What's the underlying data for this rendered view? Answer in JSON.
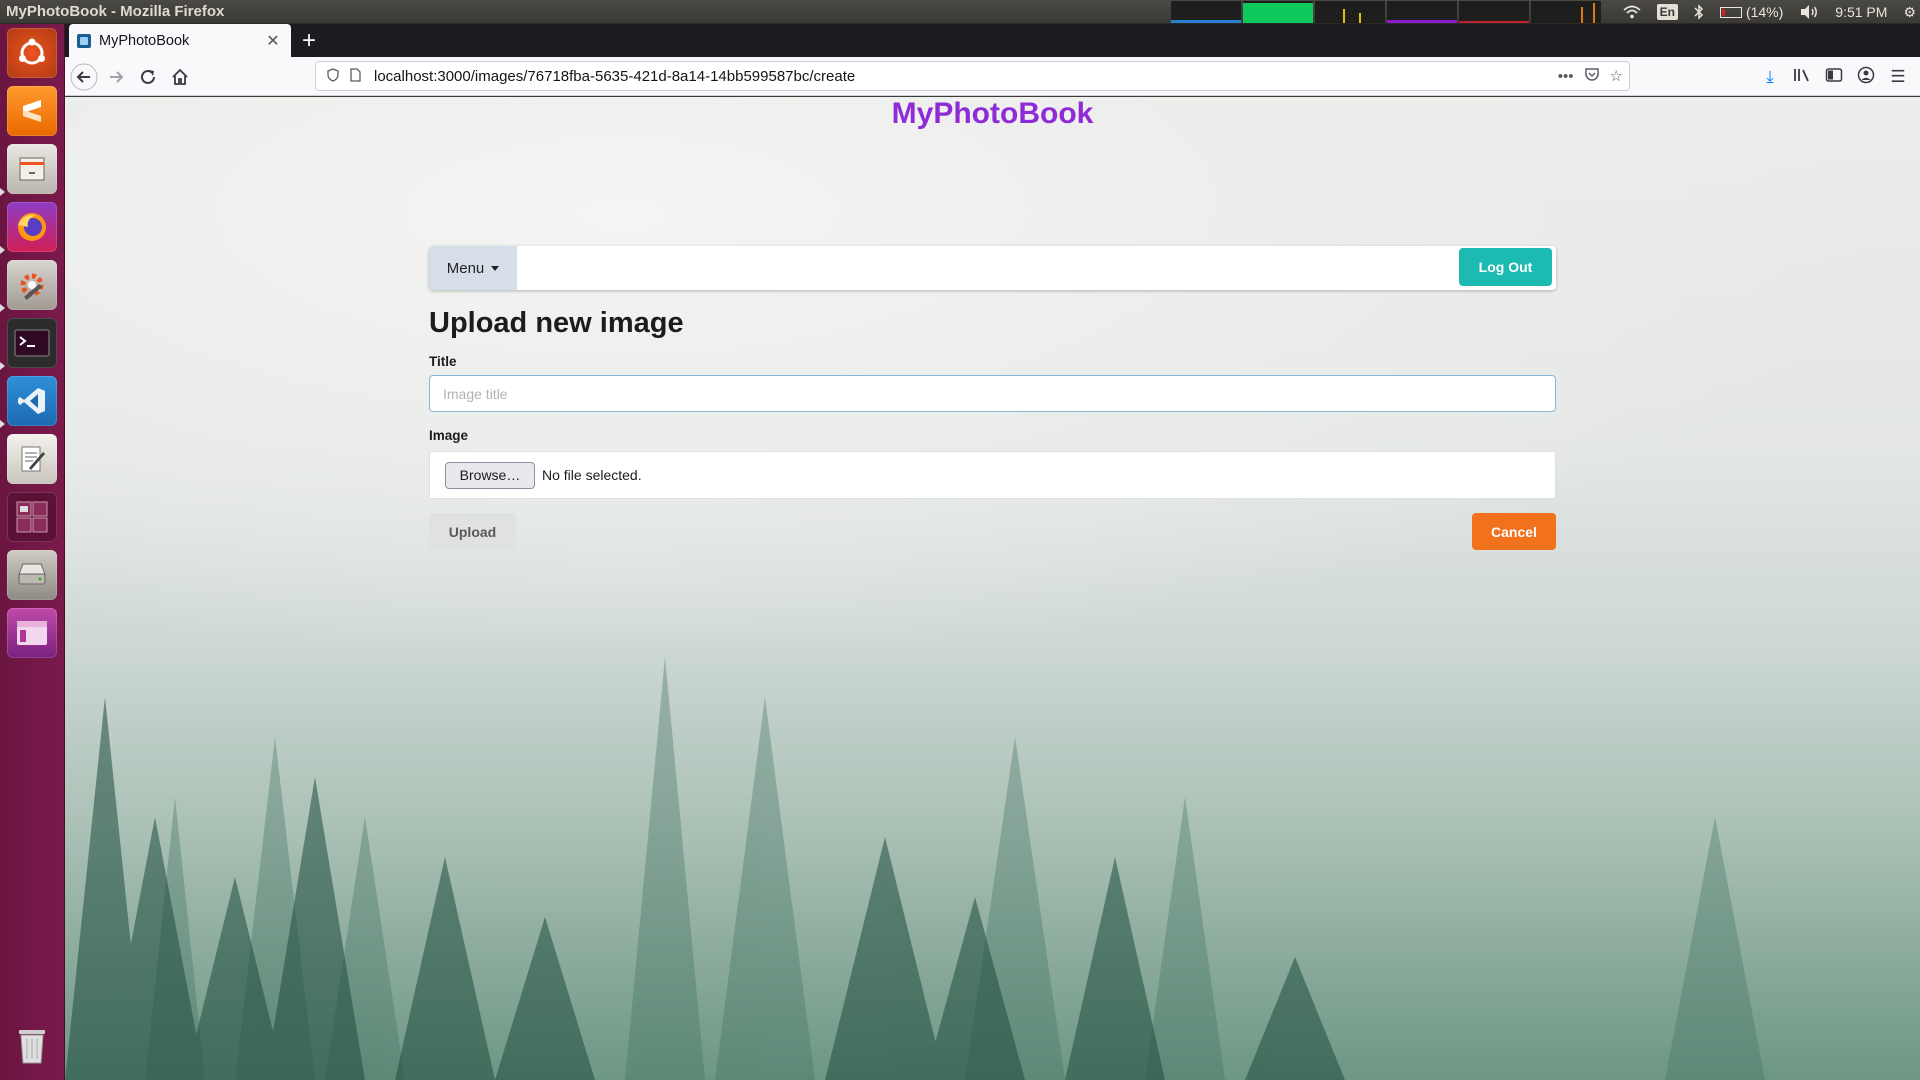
{
  "os_panel": {
    "window_title": "MyPhotoBook - Mozilla Firefox",
    "keyboard_layout": "En",
    "battery_percent": "(14%)",
    "battery_level": 0.14,
    "clock": "9:51 PM"
  },
  "browser": {
    "tab_title": "MyPhotoBook",
    "new_tab_symbol": "+",
    "url": "localhost:3000/images/76718fba-5635-421d-8a14-14bb599587bc/create"
  },
  "app": {
    "site_title": "MyPhotoBook",
    "menu_label": "Menu",
    "logout_label": "Log Out",
    "page_heading": "Upload new image",
    "title_label": "Title",
    "title_placeholder": "Image title",
    "title_value": "",
    "image_label": "Image",
    "browse_label": "Browse…",
    "file_status": "No file selected.",
    "upload_label": "Upload",
    "cancel_label": "Cancel"
  },
  "colors": {
    "site_title": "#8e2bd6",
    "logout_button": "#1dbab2",
    "cancel_button": "#f2711c",
    "upload_button": "#e0e1e2",
    "launcher": "#7a1a4c"
  },
  "launcher_icons": [
    "ubuntu-dash-icon",
    "sublime-text-icon",
    "file-cabinet-icon",
    "firefox-icon",
    "system-settings-icon",
    "terminal-icon",
    "vscode-icon",
    "text-editor-icon",
    "workspace-switcher-icon",
    "disk-drive-icon",
    "window-app-icon",
    "trash-icon"
  ]
}
